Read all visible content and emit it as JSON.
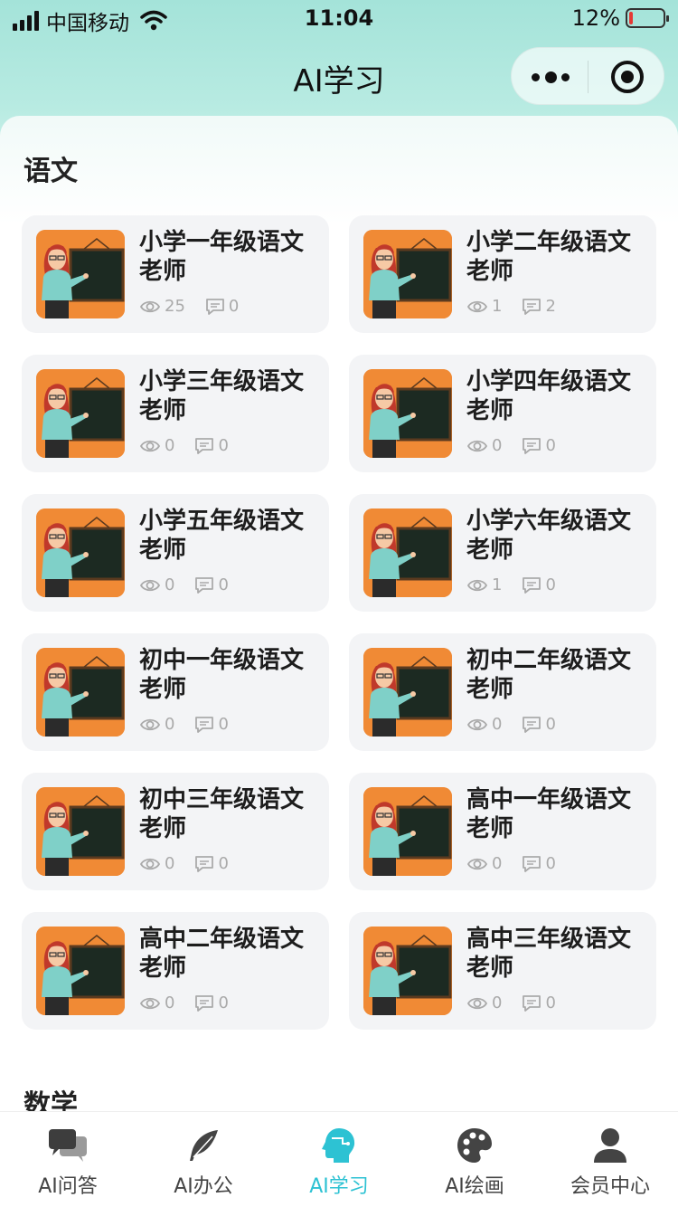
{
  "status_bar": {
    "carrier": "中国移动",
    "time": "11:04",
    "battery": "12%",
    "battery_level": 0.12
  },
  "nav": {
    "title": "AI学习"
  },
  "sections": [
    {
      "title": "语文",
      "cards": [
        {
          "title": "小学一年级语文老师",
          "views": "25",
          "comments": "0"
        },
        {
          "title": "小学二年级语文老师",
          "views": "1",
          "comments": "2"
        },
        {
          "title": "小学三年级语文老师",
          "views": "0",
          "comments": "0"
        },
        {
          "title": "小学四年级语文老师",
          "views": "0",
          "comments": "0"
        },
        {
          "title": "小学五年级语文老师",
          "views": "0",
          "comments": "0"
        },
        {
          "title": "小学六年级语文老师",
          "views": "1",
          "comments": "0"
        },
        {
          "title": "初中一年级语文老师",
          "views": "0",
          "comments": "0"
        },
        {
          "title": "初中二年级语文老师",
          "views": "0",
          "comments": "0"
        },
        {
          "title": "初中三年级语文老师",
          "views": "0",
          "comments": "0"
        },
        {
          "title": "高中一年级语文老师",
          "views": "0",
          "comments": "0"
        },
        {
          "title": "高中二年级语文老师",
          "views": "0",
          "comments": "0"
        },
        {
          "title": "高中三年级语文老师",
          "views": "0",
          "comments": "0"
        }
      ]
    },
    {
      "title": "数学"
    }
  ],
  "tabbar": {
    "items": [
      {
        "label": "AI问答",
        "icon": "chat-bubbles-icon"
      },
      {
        "label": "AI办公",
        "icon": "feather-icon"
      },
      {
        "label": "AI学习",
        "icon": "head-icon",
        "active": true
      },
      {
        "label": "AI绘画",
        "icon": "palette-icon"
      },
      {
        "label": "会员中心",
        "icon": "user-icon"
      }
    ]
  },
  "colors": {
    "header_gradient": "#a4e3d9",
    "accent": "#2dc2d3",
    "card_bg": "#f3f4f6",
    "thumb_bg": "#f08a35"
  }
}
